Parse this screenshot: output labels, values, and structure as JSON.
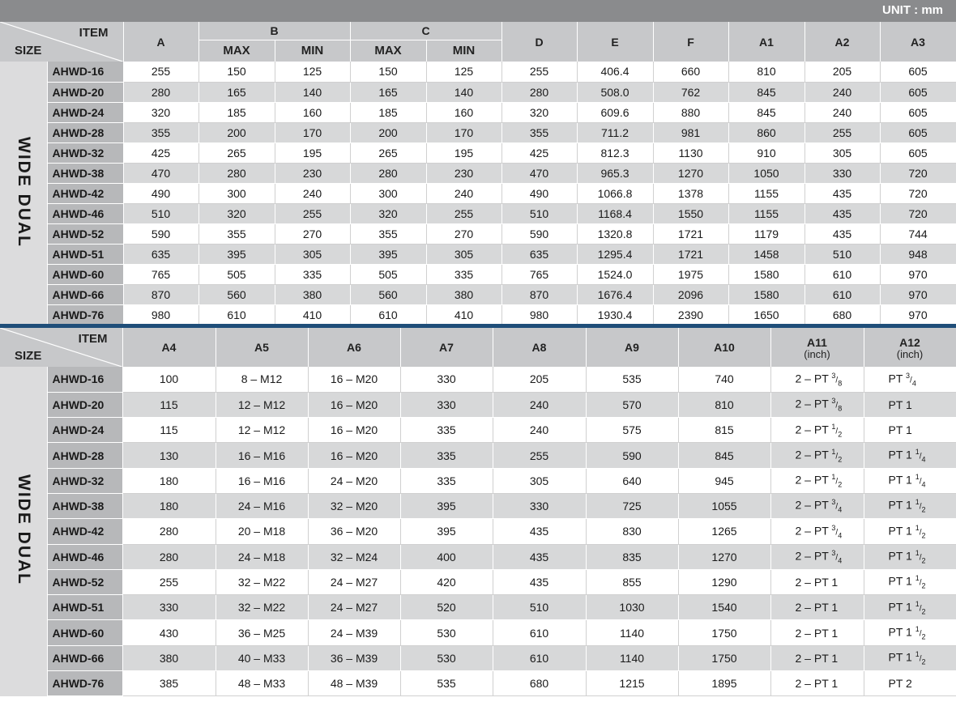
{
  "unit": "UNIT : mm",
  "side_label": "WIDE DUAL",
  "header": {
    "item": "ITEM",
    "size": "SIZE"
  },
  "table1": {
    "columns": {
      "A": "A",
      "B": "B",
      "C": "C",
      "max": "MAX",
      "min": "MIN",
      "D": "D",
      "E": "E",
      "F": "F",
      "A1": "A1",
      "A2": "A2",
      "A3": "A3"
    },
    "rows": [
      [
        "AHWD-16",
        "255",
        "150",
        "125",
        "150",
        "125",
        "255",
        "406.4",
        "660",
        "810",
        "205",
        "605"
      ],
      [
        "AHWD-20",
        "280",
        "165",
        "140",
        "165",
        "140",
        "280",
        "508.0",
        "762",
        "845",
        "240",
        "605"
      ],
      [
        "AHWD-24",
        "320",
        "185",
        "160",
        "185",
        "160",
        "320",
        "609.6",
        "880",
        "845",
        "240",
        "605"
      ],
      [
        "AHWD-28",
        "355",
        "200",
        "170",
        "200",
        "170",
        "355",
        "711.2",
        "981",
        "860",
        "255",
        "605"
      ],
      [
        "AHWD-32",
        "425",
        "265",
        "195",
        "265",
        "195",
        "425",
        "812.3",
        "1130",
        "910",
        "305",
        "605"
      ],
      [
        "AHWD-38",
        "470",
        "280",
        "230",
        "280",
        "230",
        "470",
        "965.3",
        "1270",
        "1050",
        "330",
        "720"
      ],
      [
        "AHWD-42",
        "490",
        "300",
        "240",
        "300",
        "240",
        "490",
        "1066.8",
        "1378",
        "1155",
        "435",
        "720"
      ],
      [
        "AHWD-46",
        "510",
        "320",
        "255",
        "320",
        "255",
        "510",
        "1168.4",
        "1550",
        "1155",
        "435",
        "720"
      ],
      [
        "AHWD-52",
        "590",
        "355",
        "270",
        "355",
        "270",
        "590",
        "1320.8",
        "1721",
        "1179",
        "435",
        "744"
      ],
      [
        "AHWD-51",
        "635",
        "395",
        "305",
        "395",
        "305",
        "635",
        "1295.4",
        "1721",
        "1458",
        "510",
        "948"
      ],
      [
        "AHWD-60",
        "765",
        "505",
        "335",
        "505",
        "335",
        "765",
        "1524.0",
        "1975",
        "1580",
        "610",
        "970"
      ],
      [
        "AHWD-66",
        "870",
        "560",
        "380",
        "560",
        "380",
        "870",
        "1676.4",
        "2096",
        "1580",
        "610",
        "970"
      ],
      [
        "AHWD-76",
        "980",
        "610",
        "410",
        "610",
        "410",
        "980",
        "1930.4",
        "2390",
        "1650",
        "680",
        "970"
      ]
    ]
  },
  "table2": {
    "columns": [
      "A4",
      "A5",
      "A6",
      "A7",
      "A8",
      "A9",
      "A10",
      "A11",
      "A12"
    ],
    "unit_inch": "(inch)",
    "rows": [
      {
        "name": "AHWD-16",
        "vals": [
          "100",
          "8 – M12",
          "16 – M20",
          "330",
          "205",
          "535",
          "740"
        ],
        "a11": "2 – PT ",
        "a11n": "3",
        "a11d": "8",
        "a12": "PT ",
        "a12n": "3",
        "a12d": "4"
      },
      {
        "name": "AHWD-20",
        "vals": [
          "115",
          "12 – M12",
          "16 – M20",
          "330",
          "240",
          "570",
          "810"
        ],
        "a11": "2 – PT ",
        "a11n": "3",
        "a11d": "8",
        "a12": "PT 1",
        "a12n": "",
        "a12d": ""
      },
      {
        "name": "AHWD-24",
        "vals": [
          "115",
          "12 – M12",
          "16 – M20",
          "335",
          "240",
          "575",
          "815"
        ],
        "a11": "2 – PT ",
        "a11n": "1",
        "a11d": "2",
        "a12": "PT 1",
        "a12n": "",
        "a12d": ""
      },
      {
        "name": "AHWD-28",
        "vals": [
          "130",
          "16 – M16",
          "16 – M20",
          "335",
          "255",
          "590",
          "845"
        ],
        "a11": "2 – PT ",
        "a11n": "1",
        "a11d": "2",
        "a12": "PT 1 ",
        "a12n": "1",
        "a12d": "4"
      },
      {
        "name": "AHWD-32",
        "vals": [
          "180",
          "16 – M16",
          "24 – M20",
          "335",
          "305",
          "640",
          "945"
        ],
        "a11": "2 – PT ",
        "a11n": "1",
        "a11d": "2",
        "a12": "PT 1 ",
        "a12n": "1",
        "a12d": "4"
      },
      {
        "name": "AHWD-38",
        "vals": [
          "180",
          "24 – M16",
          "32 – M20",
          "395",
          "330",
          "725",
          "1055"
        ],
        "a11": "2 – PT ",
        "a11n": "3",
        "a11d": "4",
        "a12": "PT 1 ",
        "a12n": "1",
        "a12d": "2"
      },
      {
        "name": "AHWD-42",
        "vals": [
          "280",
          "20 – M18",
          "36 – M20",
          "395",
          "435",
          "830",
          "1265"
        ],
        "a11": "2 – PT ",
        "a11n": "3",
        "a11d": "4",
        "a12": "PT 1 ",
        "a12n": "1",
        "a12d": "2"
      },
      {
        "name": "AHWD-46",
        "vals": [
          "280",
          "24 – M18",
          "32 – M24",
          "400",
          "435",
          "835",
          "1270"
        ],
        "a11": "2 – PT ",
        "a11n": "3",
        "a11d": "4",
        "a12": "PT 1 ",
        "a12n": "1",
        "a12d": "2"
      },
      {
        "name": "AHWD-52",
        "vals": [
          "255",
          "32 – M22",
          "24 – M27",
          "420",
          "435",
          "855",
          "1290"
        ],
        "a11": "2 – PT 1",
        "a11n": "",
        "a11d": "",
        "a12": "PT 1 ",
        "a12n": "1",
        "a12d": "2"
      },
      {
        "name": "AHWD-51",
        "vals": [
          "330",
          "32 – M22",
          "24 – M27",
          "520",
          "510",
          "1030",
          "1540"
        ],
        "a11": "2 – PT 1",
        "a11n": "",
        "a11d": "",
        "a12": "PT 1 ",
        "a12n": "1",
        "a12d": "2"
      },
      {
        "name": "AHWD-60",
        "vals": [
          "430",
          "36 – M25",
          "24 – M39",
          "530",
          "610",
          "1140",
          "1750"
        ],
        "a11": "2 – PT 1",
        "a11n": "",
        "a11d": "",
        "a12": "PT 1 ",
        "a12n": "1",
        "a12d": "2"
      },
      {
        "name": "AHWD-66",
        "vals": [
          "380",
          "40 – M33",
          "36 – M39",
          "530",
          "610",
          "1140",
          "1750"
        ],
        "a11": "2 – PT 1",
        "a11n": "",
        "a11d": "",
        "a12": "PT 1 ",
        "a12n": "1",
        "a12d": "2"
      },
      {
        "name": "AHWD-76",
        "vals": [
          "385",
          "48 – M33",
          "48 – M39",
          "535",
          "680",
          "1215",
          "1895"
        ],
        "a11": "2 – PT 1",
        "a11n": "",
        "a11d": "",
        "a12": "PT 2",
        "a12n": "",
        "a12d": ""
      }
    ]
  }
}
